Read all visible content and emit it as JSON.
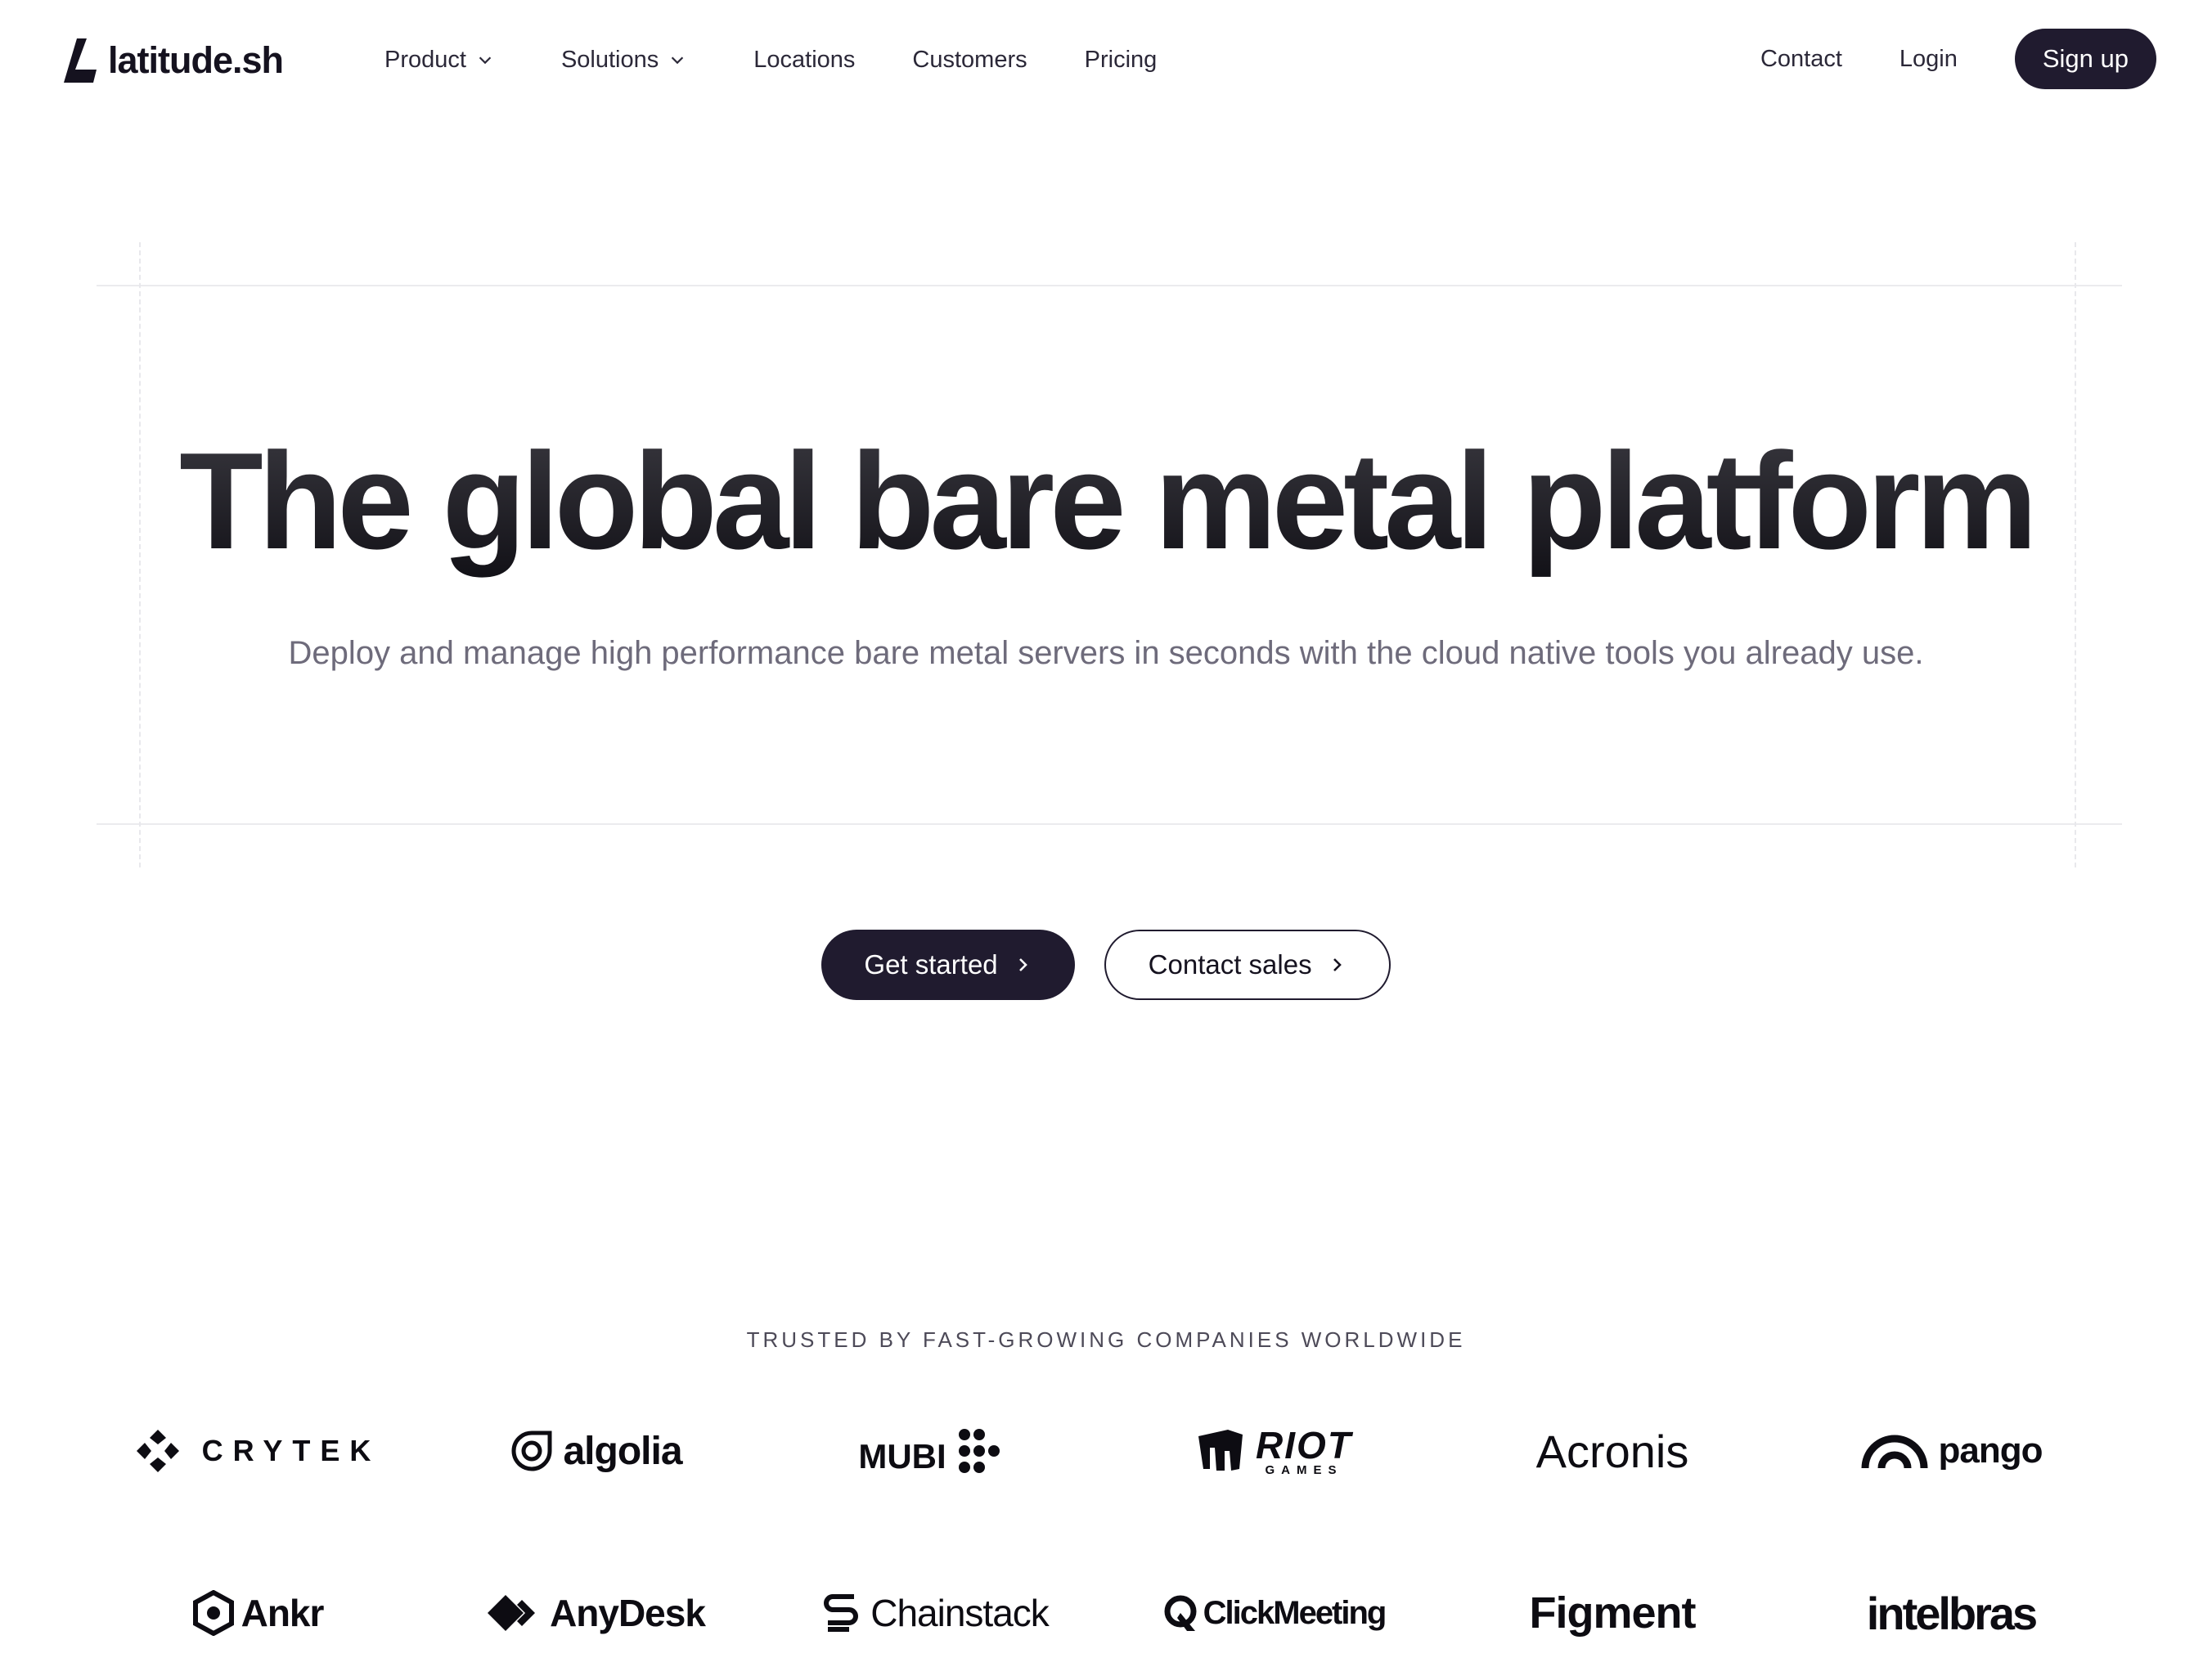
{
  "nav": {
    "brand": "latitude.sh",
    "links": [
      "Product",
      "Solutions",
      "Locations",
      "Customers",
      "Pricing"
    ],
    "contact": "Contact",
    "login": "Login",
    "signup": "Sign up"
  },
  "hero": {
    "title": "The global bare metal platform",
    "subtitle": "Deploy and manage high performance bare metal servers in seconds with the cloud native tools you already use.",
    "primary_cta": "Get started",
    "secondary_cta": "Contact sales"
  },
  "trusted": {
    "label": "TRUSTED BY FAST-GROWING COMPANIES WORLDWIDE",
    "row1": [
      "CRYTEK",
      "algolia",
      "MUBI",
      "RIOT",
      "Acronis",
      "pango"
    ],
    "riot_sub": "GAMES",
    "row2": [
      "Ankr",
      "AnyDesk",
      "Chainstack",
      "ClickMeeting",
      "Figment",
      "intelbras"
    ]
  },
  "colors": {
    "accent": "#201b2f",
    "muted_text": "#6e6b7b",
    "border": "#ebebee"
  }
}
